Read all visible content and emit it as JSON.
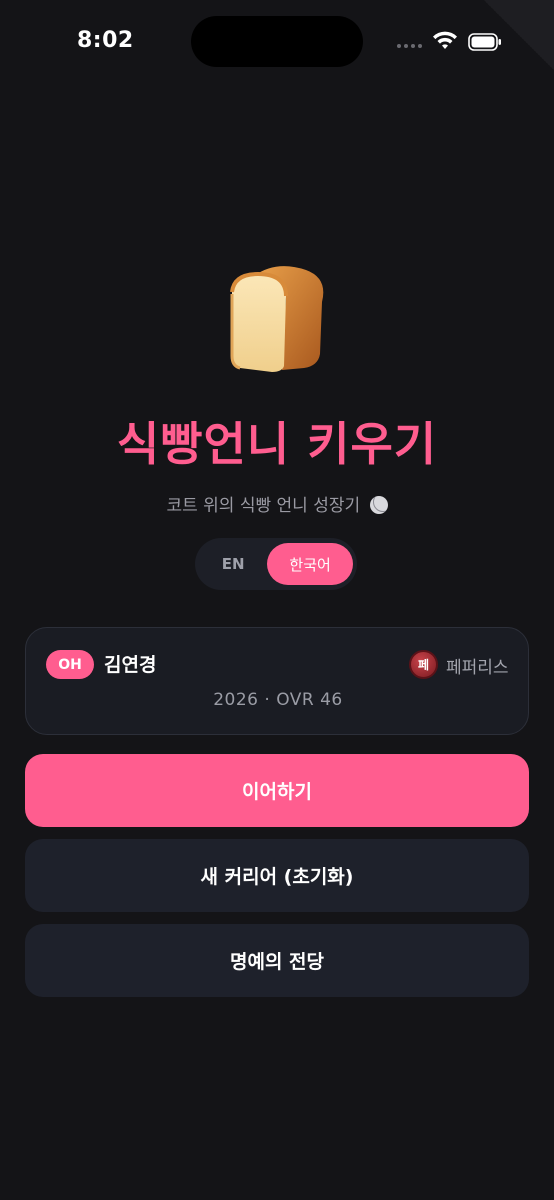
{
  "status_bar": {
    "time": "8:02"
  },
  "hero": {
    "icon": "bread-icon",
    "title": "식빵언니 키우기",
    "subtitle": "코트 위의 식빵 언니 성장기"
  },
  "language_toggle": {
    "options": [
      "EN",
      "한국어"
    ],
    "selected": "한국어"
  },
  "player_card": {
    "position": "OH",
    "name": "김연경",
    "team_logo_text": "페",
    "team_name": "페퍼리스",
    "season_ovr": "2026 · OVR 46"
  },
  "buttons": {
    "continue": "이어하기",
    "new_career": "새 커리어 (초기화)",
    "hall_of_fame": "명예의 전당"
  },
  "colors": {
    "background": "#141417",
    "accent": "#ff5d8f",
    "card": "#1a1c23",
    "button_secondary": "#1e212b"
  }
}
